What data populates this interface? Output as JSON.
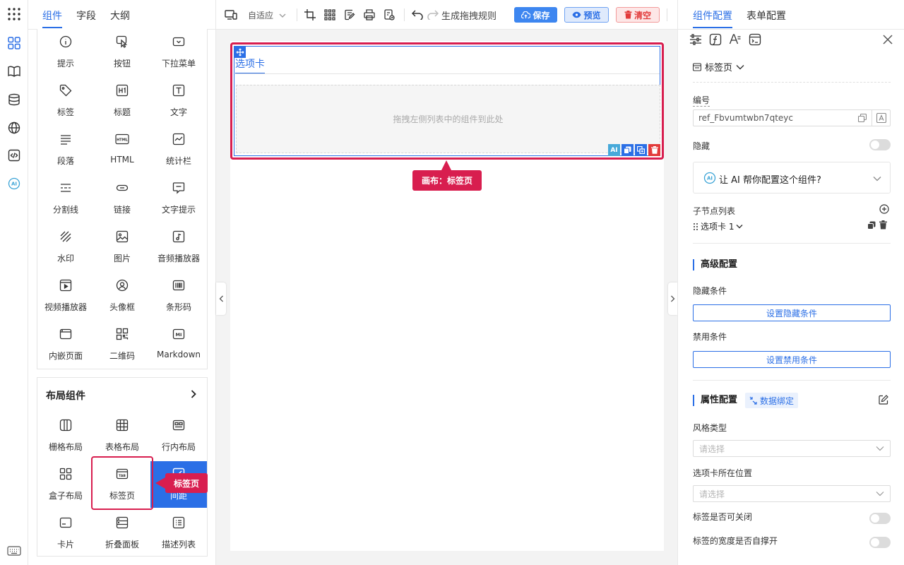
{
  "left_tabs": [
    "组件",
    "字段",
    "大纲"
  ],
  "basic_components": [
    "提示",
    "按钮",
    "下拉菜单",
    "标签",
    "标题",
    "文字",
    "段落",
    "HTML",
    "统计栏",
    "分割线",
    "链接",
    "文字提示",
    "水印",
    "图片",
    "音频播放器",
    "视频播放器",
    "头像框",
    "条形码",
    "内嵌页面",
    "二维码",
    "Markdown"
  ],
  "layout_section": {
    "title": "布局组件",
    "items": [
      "栅格布局",
      "表格布局",
      "行内布局",
      "盒子布局",
      "标签页",
      "间距",
      "卡片",
      "折叠面板",
      "描述列表"
    ]
  },
  "left_callout": "标签页",
  "toolbar": {
    "adaptive": "自适应",
    "rule": "生成拖拽规则",
    "save": "保存",
    "preview": "预览",
    "clear": "清空"
  },
  "canvas": {
    "tab_label": "选项卡",
    "dropzone_text": "拖拽左侧列表中的组件到此处",
    "callout": "画布：标签页",
    "ai_badge": "AI"
  },
  "right_tabs": [
    "组件配置",
    "表单配置"
  ],
  "config": {
    "component_type": "标签页",
    "id_label": "编号",
    "id_value": "ref_Fbvumtwbn7qteyc",
    "hidden_label": "隐藏",
    "ai_prompt": "让 AI 帮你配置这个组件?",
    "ai_icon_text": "AI",
    "children_label": "子节点列表",
    "child_item": "选项卡 1",
    "advanced_title": "高级配置",
    "hide_cond_label": "隐藏条件",
    "hide_cond_btn": "设置隐藏条件",
    "disable_cond_label": "禁用条件",
    "disable_cond_btn": "设置禁用条件",
    "prop_title": "属性配置",
    "data_bind": "数据绑定",
    "style_label": "风格类型",
    "style_placeholder": "请选择",
    "position_label": "选项卡所在位置",
    "position_placeholder": "请选择",
    "closable_label": "标签是否可关闭",
    "stretch_label": "标签的宽度是否自撑开"
  },
  "colors": {
    "accent": "#2b6fe6",
    "highlight": "#d81e4f",
    "danger": "#e23b3b"
  }
}
